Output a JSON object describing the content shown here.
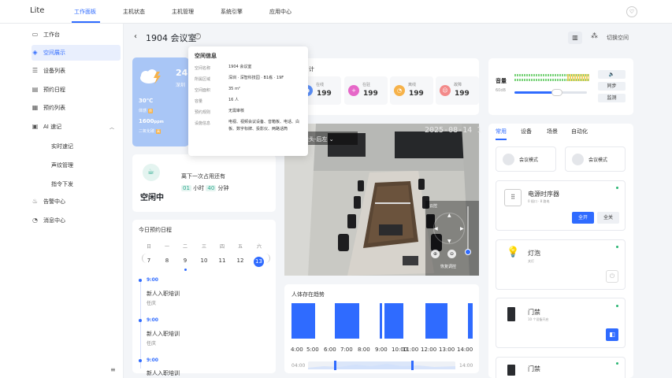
{
  "topbar": {
    "logo": "Lite",
    "nav": [
      "工作面板",
      "主机状态",
      "主机管理",
      "系统引擎",
      "应用中心"
    ],
    "active_nav": "工作面板"
  },
  "sidebar": {
    "items": [
      {
        "label": "工作台",
        "icon": "monitor-icon"
      },
      {
        "label": "空间展示",
        "icon": "cube-icon"
      },
      {
        "label": "设备列表",
        "icon": "list-icon"
      },
      {
        "label": "预约日程",
        "icon": "calendar-icon"
      },
      {
        "label": "预约列表",
        "icon": "table-icon"
      },
      {
        "label": "AI 速记",
        "icon": "ai-note-icon"
      },
      {
        "label": "告警中心",
        "icon": "alarm-icon"
      },
      {
        "label": "消息中心",
        "icon": "bell-icon"
      }
    ],
    "ai_sub": [
      "实时速记",
      "声纹管理",
      "指令下发"
    ],
    "collapse": "≡"
  },
  "header": {
    "title": "1904 会议室",
    "switch_label": "切换空间"
  },
  "popover": {
    "title": "空间信息",
    "rows": [
      {
        "k": "空间名称",
        "v": "1904 会议室"
      },
      {
        "k": "所属区域",
        "v": "深圳 · 深智科技园 · B1栋 · 19F"
      },
      {
        "k": "空间面积",
        "v": "35 m²"
      },
      {
        "k": "容量",
        "v": "16 人"
      },
      {
        "k": "预约规则",
        "v": "无需审核"
      },
      {
        "k": "设施信息",
        "v": "电视、视频会议设备、音箱板、电话、白板、数字标牌、投影仪、两路话筒"
      }
    ]
  },
  "weather": {
    "temp_big": "24",
    "temp_sub": "深圳",
    "temp_line": "30℃",
    "temp_line_sub": "体感",
    "temp_tag": "良",
    "co2": "1600",
    "co2_unit": "ppm",
    "co2_sub": "二氧化碳",
    "co2_tag": "高"
  },
  "status": {
    "state": "空闲中",
    "next_label": "离下一次占用还有",
    "hours": "01",
    "hour_unit": "小时",
    "minutes": "40",
    "minute_unit": "分钟"
  },
  "schedule": {
    "title": "今日预约日程",
    "weekdays": [
      "日",
      "一",
      "二",
      "三",
      "四",
      "五",
      "六"
    ],
    "days": [
      "7",
      "8",
      "9",
      "10",
      "11",
      "12",
      "13"
    ],
    "events": [
      {
        "time": "9:00",
        "title": "新人入职培训",
        "user": "任庆"
      },
      {
        "time": "9:00",
        "title": "新人入职培训",
        "user": "任庆"
      },
      {
        "time": "9:00",
        "title": "新人入职培训",
        "user": ""
      }
    ]
  },
  "stats": {
    "title_suffix": "计",
    "items": [
      {
        "label": "在线",
        "value": "199",
        "color": "#5b8ff9"
      },
      {
        "label": "在驻",
        "value": "199",
        "color": "#e667c8"
      },
      {
        "label": "离线",
        "value": "199",
        "color": "#f6b24a"
      },
      {
        "label": "故障",
        "value": "199",
        "color": "#f38a8a"
      }
    ]
  },
  "camera": {
    "timestamp": "2025-08-14 1",
    "select_label": "摄像头-后左",
    "ptz_label": "云控",
    "reset_label": "恢复调控"
  },
  "trend": {
    "title": "人体存在趋势",
    "labels": [
      "4:00",
      "5:00",
      "6:00",
      "7:00",
      "8:00",
      "9:00",
      "10:00",
      "11:00",
      "12:00",
      "13:00",
      "14:00"
    ],
    "timeline_start": "04:00",
    "timeline_end": "14:00"
  },
  "volume": {
    "title": "音量",
    "sub": "60dB",
    "level": 0.6,
    "buttons": [
      "同步",
      "监测"
    ]
  },
  "devices": {
    "tabs": [
      "常用",
      "设备",
      "场景",
      "自动化"
    ],
    "modes": [
      "会议模式",
      "会议模式"
    ],
    "items": [
      {
        "name": "电源时序器",
        "sub": "0 插口 · 8 路电",
        "btn_on": "全开",
        "btn_off": "全关"
      },
      {
        "name": "灯泡",
        "sub": "关灯"
      },
      {
        "name": "门禁",
        "sub": "10 个设备开启"
      },
      {
        "name": "门禁",
        "sub": ""
      }
    ]
  },
  "colors": {
    "accent": "#2f6bff",
    "weather_bg": "#a9c6f6",
    "idle_green": "#2ba98d"
  }
}
